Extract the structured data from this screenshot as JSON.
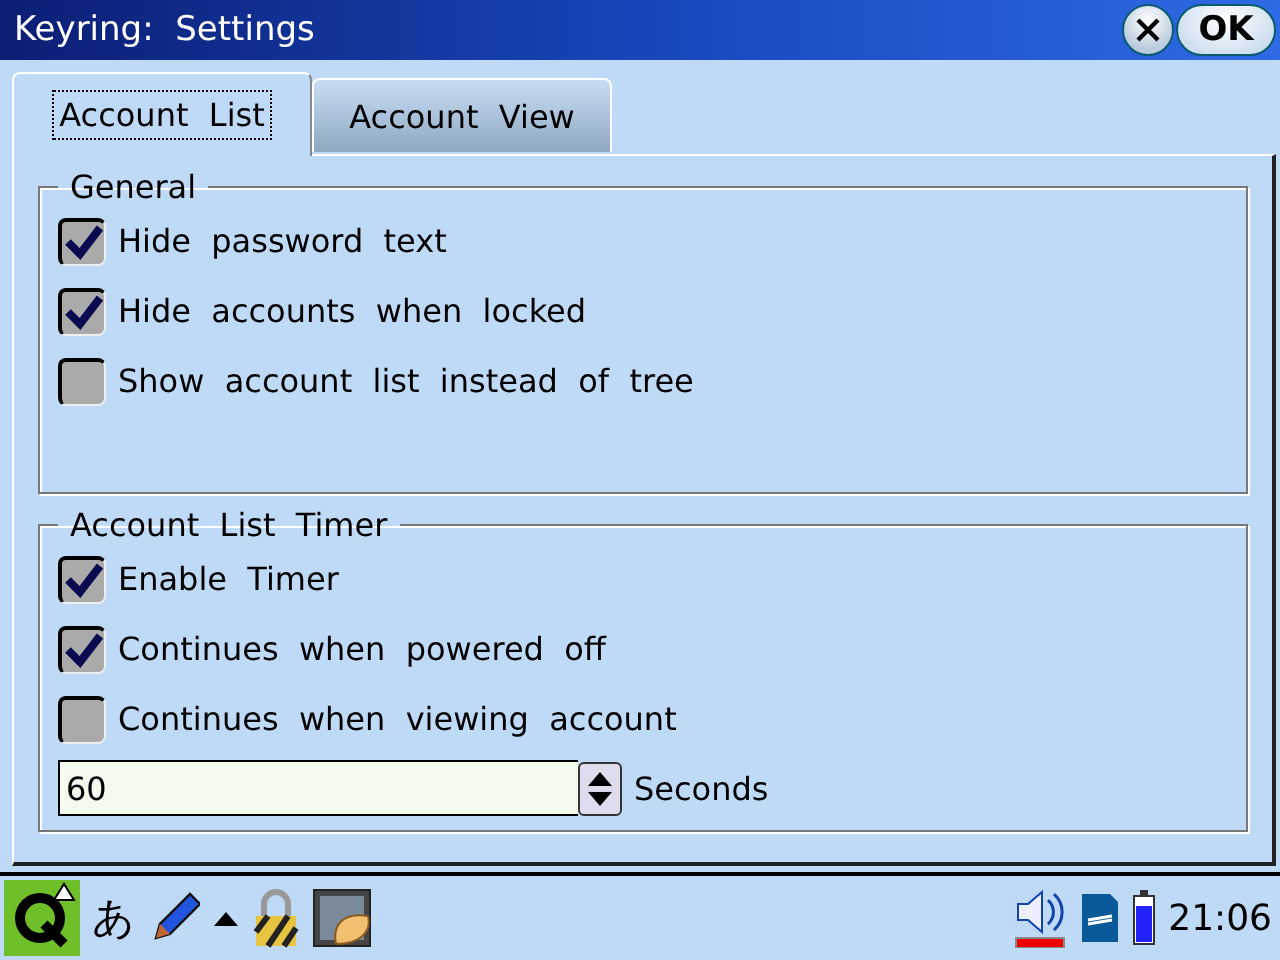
{
  "window": {
    "title": "Keyring:  Settings",
    "ok_label": "OK"
  },
  "tabs": [
    {
      "label": "Account  List",
      "selected": true
    },
    {
      "label": "Account  View",
      "selected": false
    }
  ],
  "groups": [
    {
      "title": "General",
      "items": [
        {
          "label": "Hide  password  text",
          "checked": true
        },
        {
          "label": "Hide  accounts  when  locked",
          "checked": true
        },
        {
          "label": "Show  account  list  instead  of  tree",
          "checked": false
        }
      ]
    },
    {
      "title": "Account  List  Timer",
      "items": [
        {
          "label": "Enable  Timer",
          "checked": true
        },
        {
          "label": "Continues  when  powered  off",
          "checked": true
        },
        {
          "label": "Continues  when  viewing  account",
          "checked": false
        }
      ],
      "spin": {
        "value": "60",
        "unit": "Seconds"
      }
    }
  ],
  "taskbar": {
    "input_method": "あ",
    "clock": "21:06"
  }
}
